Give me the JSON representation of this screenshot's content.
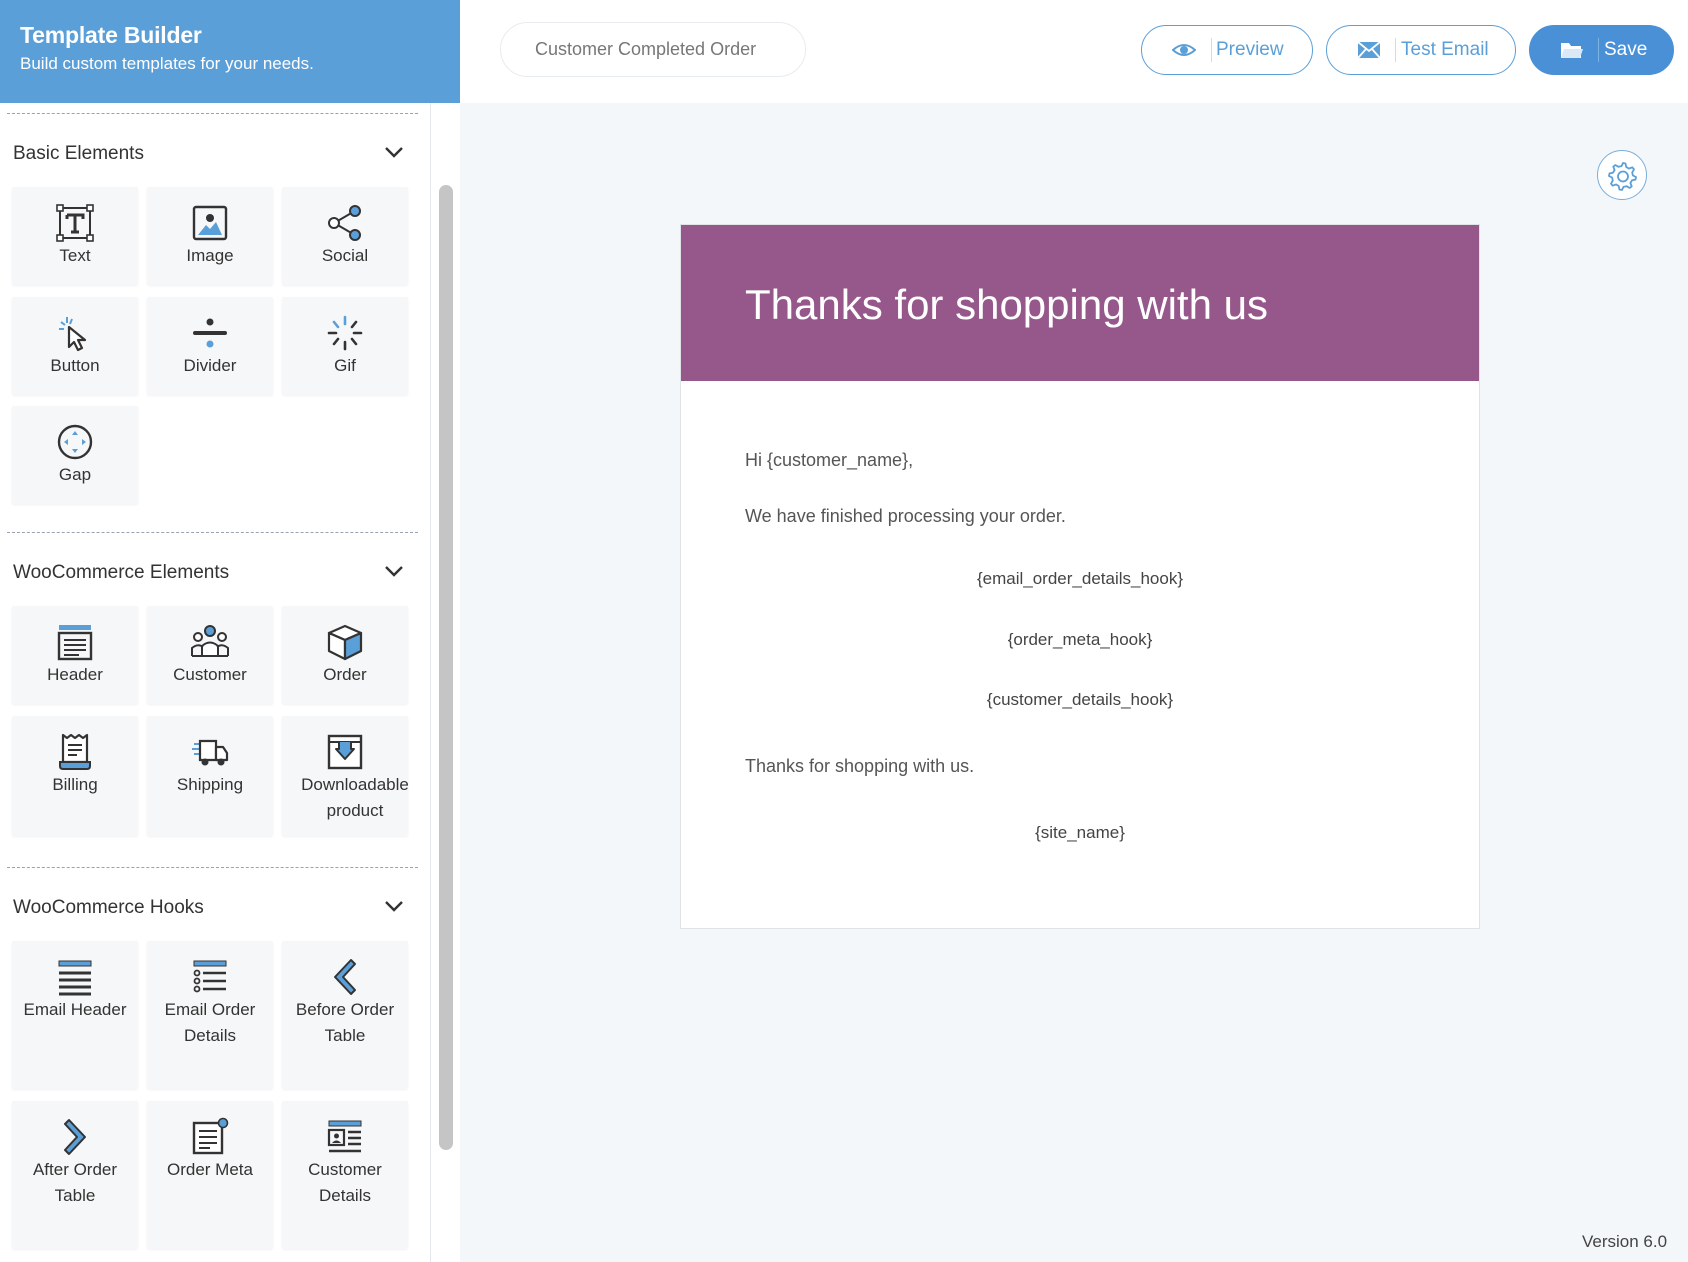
{
  "brand": {
    "title": "Template Builder",
    "subtitle": "Build custom templates for your needs."
  },
  "sections": {
    "basic": {
      "title": "Basic Elements",
      "items": [
        "Text",
        "Image",
        "Social",
        "Button",
        "Divider",
        "Gif",
        "Gap"
      ]
    },
    "woo": {
      "title": "WooCommerce Elements",
      "items": [
        "Header",
        "Customer",
        "Order",
        "Billing",
        "Shipping",
        "Downloadable product"
      ]
    },
    "hooks": {
      "title": "WooCommerce Hooks",
      "items": [
        "Email Header",
        "Email Order Details",
        "Before Order Table",
        "After Order Table",
        "Order Meta",
        "Customer Details"
      ]
    }
  },
  "topbar": {
    "template_name": "Customer Completed Order",
    "preview_label": "Preview",
    "test_email_label": "Test Email",
    "save_label": "Save"
  },
  "email": {
    "header_title": "Thanks for shopping with us",
    "header_color": "#96588a",
    "greeting": "Hi {customer_name},",
    "body_line": "We have finished processing your order.",
    "order_details_hook": "{email_order_details_hook}",
    "order_meta_hook": "{order_meta_hook}",
    "customer_details_hook": "{customer_details_hook}",
    "closing": "Thanks for shopping with us.",
    "site_name": "{site_name}"
  },
  "footer": {
    "version": "Version 6.0"
  },
  "colors": {
    "brand": "#5b9fd8",
    "accent": "#4a90d6"
  }
}
